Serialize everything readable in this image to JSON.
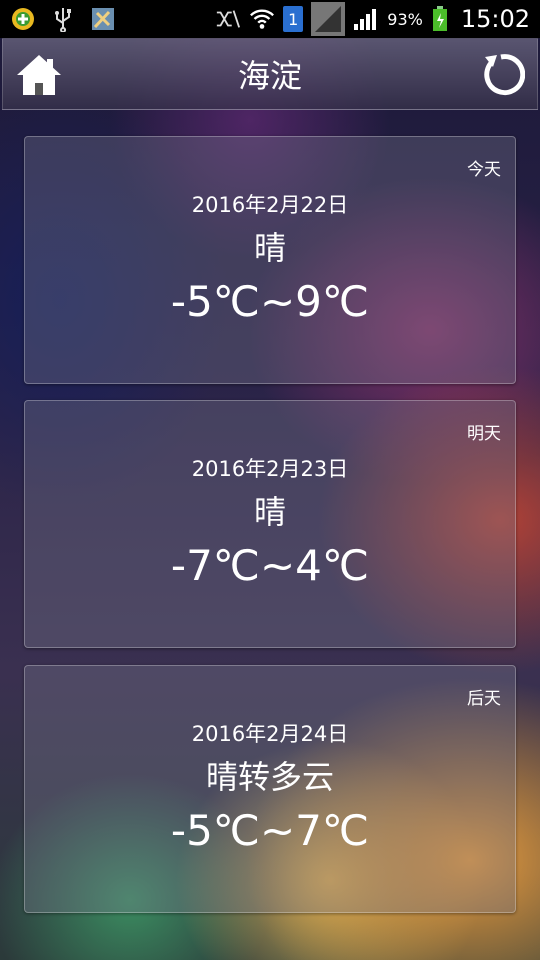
{
  "status_bar": {
    "icons_left": [
      "app-icon",
      "usb-icon",
      "tool-icon"
    ],
    "icons_right": [
      "silent-icon",
      "wifi-icon",
      "sim1-icon",
      "signal-icon",
      "signal-bars-icon",
      "battery-icon"
    ],
    "sim_label": "1",
    "battery_percent": "93%",
    "time": "15:02"
  },
  "header": {
    "title": "海淀",
    "home_icon": "home-icon",
    "refresh_icon": "refresh-icon"
  },
  "cards": [
    {
      "tag": "今天",
      "date": "2016年2月22日",
      "weather": "晴",
      "temp": "-5℃~9℃"
    },
    {
      "tag": "明天",
      "date": "2016年2月23日",
      "weather": "晴",
      "temp": "-7℃~4℃"
    },
    {
      "tag": "后天",
      "date": "2016年2月24日",
      "weather": "晴转多云",
      "temp": "-5℃~7℃"
    }
  ]
}
